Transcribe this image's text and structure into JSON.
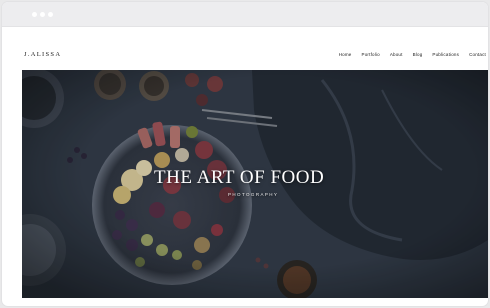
{
  "site": {
    "logo": "J.ALISSA",
    "nav": [
      {
        "label": "Home"
      },
      {
        "label": "Portfolio"
      },
      {
        "label": "About"
      },
      {
        "label": "Blog"
      },
      {
        "label": "Publications"
      },
      {
        "label": "Contact"
      }
    ]
  },
  "hero": {
    "title": "THE ART OF FOOD",
    "subtitle": "PHOTOGRAPHY"
  }
}
